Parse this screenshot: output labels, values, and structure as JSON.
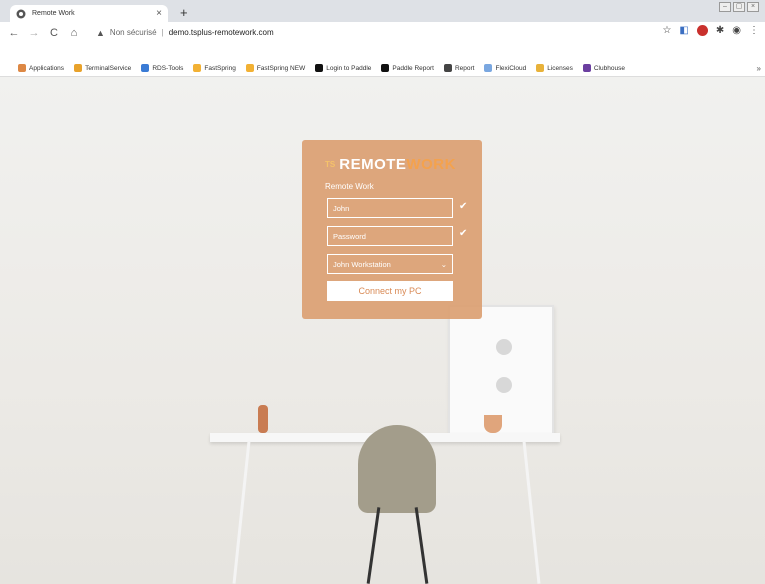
{
  "browser": {
    "tab_title": "Remote Work",
    "tab_close": "×",
    "new_tab": "+",
    "nav": {
      "back": "←",
      "forward": "→",
      "reload": "C",
      "home": "⌂"
    },
    "omnibox": {
      "warning_icon": "▲",
      "security_text": "Non sécurisé",
      "separator": "|",
      "url": "demo.tsplus-remotework.com"
    },
    "star": "☆",
    "menu": "⋮"
  },
  "bookmarks": [
    {
      "label": "Applications",
      "icon": "grid-icon",
      "color": "#d84"
    },
    {
      "label": "TerminalService",
      "icon": "ts-icon",
      "color": "#e8a22b"
    },
    {
      "label": "RDS-Tools",
      "icon": "rds-icon",
      "color": "#3a7bd5"
    },
    {
      "label": "FastSpring",
      "icon": "fastspring-icon",
      "color": "#f2b134"
    },
    {
      "label": "FastSpring NEW",
      "icon": "fastspring-icon",
      "color": "#f2b134"
    },
    {
      "label": "Login to Paddle",
      "icon": "paddle-icon",
      "color": "#111"
    },
    {
      "label": "Paddle Report",
      "icon": "paddle-report-icon",
      "color": "#111"
    },
    {
      "label": "Report",
      "icon": "report-icon",
      "color": "#444"
    },
    {
      "label": "FlexiCloud",
      "icon": "flexicloud-icon",
      "color": "#7aa7e0"
    },
    {
      "label": "Licenses",
      "icon": "licenses-icon",
      "color": "#e8b23a"
    },
    {
      "label": "Clubhouse",
      "icon": "clubhouse-icon",
      "color": "#6b3fa0"
    }
  ],
  "bookmarks_more": "»",
  "login": {
    "logo_ts": "TS",
    "logo_remote": "REMOTE",
    "logo_work": "WORK",
    "subtitle": "Remote Work",
    "username_value": "John",
    "password_placeholder": "Password",
    "workstation_value": "John Workstation",
    "check_mark": "✔",
    "dropdown_arrow": "⌄",
    "connect_label": "Connect my PC"
  },
  "colors": {
    "card": "#dca073",
    "accent": "#f4a24d"
  }
}
